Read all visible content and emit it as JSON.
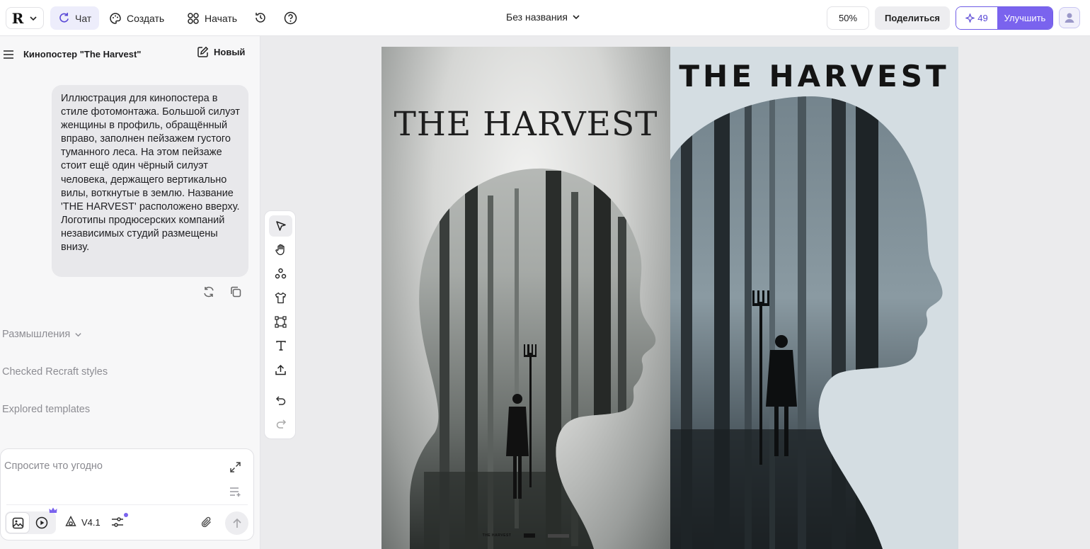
{
  "topbar": {
    "logo_mark": "R",
    "nav": [
      {
        "label": "Чат",
        "active": true
      },
      {
        "label": "Создать",
        "active": false
      },
      {
        "label": "Начать",
        "active": false
      }
    ],
    "document_title": "Без названия",
    "zoom": "50%",
    "share_label": "Поделиться",
    "credits": "49",
    "upgrade_label": "Улучшить"
  },
  "left_panel": {
    "chat_name": "Кинопостер \"The Harvest\"",
    "new_label": "Новый",
    "message": "Иллюстрация для кинопостера в стиле фотомонтажа. Большой силуэт женщины в профиль, обращённый вправо, заполнен пейзажем густого туманного леса. На этом пейзаже стоит ещё один чёрный силуэт человека, держащего вертикально вилы, воткнутые в землю. Название 'THE HARVEST' расположено вверху. Логотипы продюсерских компаний независимых студий размещены внизу.",
    "statuses": [
      "Размышления",
      "Checked Recraft styles",
      "Explored templates"
    ],
    "composer": {
      "placeholder": "Спросите что угодно",
      "model": "V4.1"
    }
  },
  "canvas": {
    "poster_left_title": "THE HARVEST",
    "poster_right_title": "THE HARVEST",
    "left_credit_title": "THE HARVEST"
  },
  "colors": {
    "accent": "#7a63ee",
    "accent_dark": "#5a49d6",
    "active_tab_bg": "#ededfb",
    "panel_bg": "#f7f7f8",
    "canvas_bg": "#ebebed"
  }
}
